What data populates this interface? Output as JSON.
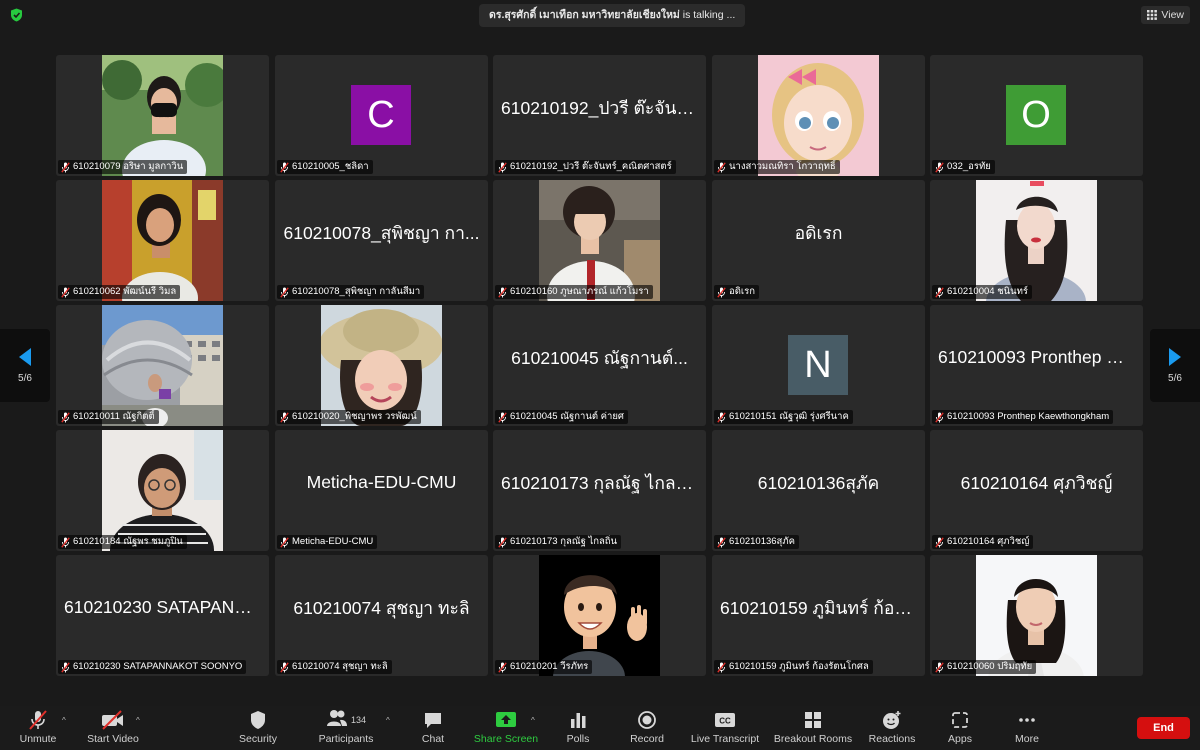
{
  "top_bar": {
    "speaker_name": "ดร.สุรศักดิ์ เมาเทือก มหาวิทยาลัยเชียงใหม่",
    "speaker_suffix": " is talking ...",
    "view_label": "View"
  },
  "pager": {
    "left": "5/6",
    "right": "5/6"
  },
  "tiles": [
    {
      "label": "610210079 อริษา มูลกาวิน",
      "type": "photo",
      "photo": "girl-mask"
    },
    {
      "label": "610210005_ชลิดา",
      "type": "avatar",
      "letter": "C",
      "color": "#8a0fa5"
    },
    {
      "label": "610210192_ปวรี ต๊ะจันทร์_คณิตศาสตร์",
      "type": "name",
      "name": "610210192_ปวรี ต๊ะจันท..."
    },
    {
      "label": "นางสาวมณทิรา โกวาฤทธิ์",
      "type": "photo",
      "photo": "cartoon-girl"
    },
    {
      "label": "032_อรทัย",
      "type": "avatar",
      "letter": "O",
      "color": "#3f9c35"
    },
    {
      "label": "610210062 พัฒน์นรี วิมล",
      "type": "photo",
      "photo": "girl-poster"
    },
    {
      "label": "610210078_สุพิชญา กาลันสีมา",
      "type": "name",
      "name": "610210078_สุพิชญา กา..."
    },
    {
      "label": "610210160 ภูษณาภรณ์ แก้วโมรา",
      "type": "photo",
      "photo": "boy-desk"
    },
    {
      "label": "อดิเรก",
      "type": "name",
      "name": "อดิเรก"
    },
    {
      "label": "610210004 ชนินทร์",
      "type": "photo",
      "photo": "girl-pink"
    },
    {
      "label": "610210011 ณัฐกิตติ์",
      "type": "photo",
      "photo": "dome"
    },
    {
      "label": "610210020_พิชญาพร วรพัฒน์",
      "type": "photo",
      "photo": "girl-hat"
    },
    {
      "label": "610210045 ณัฐกานต์ ค่ายศ",
      "type": "name",
      "name": "610210045 ณัฐกานต์..."
    },
    {
      "label": "610210151 ณัฐวุฒิ รุ่งศรีนาค",
      "type": "avatar",
      "letter": "N",
      "color": "#485c66"
    },
    {
      "label": "610210093 Pronthep Kaewthongkham",
      "type": "name",
      "name": "610210093 Pronthep Ka..."
    },
    {
      "label": "610210184 ณัฐพร ชมภูปิน",
      "type": "photo",
      "photo": "girl-glasses"
    },
    {
      "label": "Meticha-EDU-CMU",
      "type": "name",
      "name": "Meticha-EDU-CMU"
    },
    {
      "label": "610210173 กุลณัฐ ไกลถิ่น",
      "type": "name",
      "name": "610210173 กุลณัฐ ไกลถิ่น"
    },
    {
      "label": "610210136สุภัค",
      "type": "name",
      "name": "610210136สุภัค"
    },
    {
      "label": "610210164 ศุภวิชญ์",
      "type": "name",
      "name": "610210164 ศุภวิชญ์"
    },
    {
      "label": "610210230 SATAPANNAKOT SOONYO",
      "type": "name",
      "name": "610210230 SATAPANN..."
    },
    {
      "label": "610210074 สุชญา ทะลิ",
      "type": "name",
      "name": "610210074 สุชญา ทะลิ"
    },
    {
      "label": "610210201 วีรภัทร",
      "type": "photo",
      "photo": "memoji-boy"
    },
    {
      "label": "610210159 ภูมินทร์ ก้องรัตนโกศล",
      "type": "name",
      "name": "610210159 ภูมินทร์ ก้อง..."
    },
    {
      "label": "610210060 ปริมฤทัย",
      "type": "photo",
      "photo": "girl-portrait"
    }
  ],
  "toolbar": {
    "unmute": "Unmute",
    "start_video": "Start Video",
    "security": "Security",
    "participants": "Participants",
    "participants_count": "134",
    "chat": "Chat",
    "share_screen": "Share Screen",
    "polls": "Polls",
    "record": "Record",
    "live_transcript": "Live Transcript",
    "breakout_rooms": "Breakout Rooms",
    "reactions": "Reactions",
    "apps": "Apps",
    "more": "More",
    "end": "End",
    "share_color": "#2ecc40",
    "end_color": "#d50f0f"
  }
}
